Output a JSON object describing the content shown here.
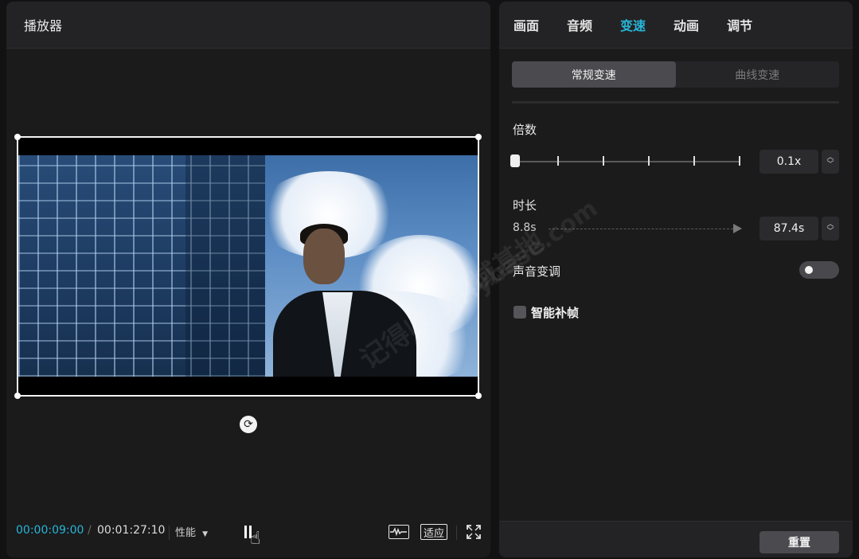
{
  "player": {
    "title": "播放器",
    "current_time": "00:00:09:00",
    "separator": "/",
    "total_time": "00:01:27:10",
    "performance_label": "性能",
    "fit_label": "适应"
  },
  "props": {
    "tabs": [
      "画面",
      "音频",
      "变速",
      "动画",
      "调节"
    ],
    "active_tab": "变速",
    "segments": [
      "常规变速",
      "曲线变速"
    ],
    "active_segment": "常规变速",
    "multiplier_label": "倍数",
    "multiplier_value": "0.1x",
    "duration_label": "时长",
    "duration_from": "8.8s",
    "duration_value": "87.4s",
    "pitch_label": "声音变调",
    "pitch_enabled": false,
    "smart_frame_label": "智能补帧",
    "smart_frame_checked": false,
    "reset_label": "重置"
  },
  "watermark": {
    "line1": "记得收藏黑域基地",
    "line2": "Hybase.com"
  },
  "colors": {
    "accent": "#27b6d8",
    "panel": "#1b1b1c",
    "header": "#232325"
  },
  "icons": {
    "rotate": "rotate-icon",
    "pause": "pause-icon",
    "waveform": "waveform-icon",
    "fullscreen": "fullscreen-icon"
  }
}
